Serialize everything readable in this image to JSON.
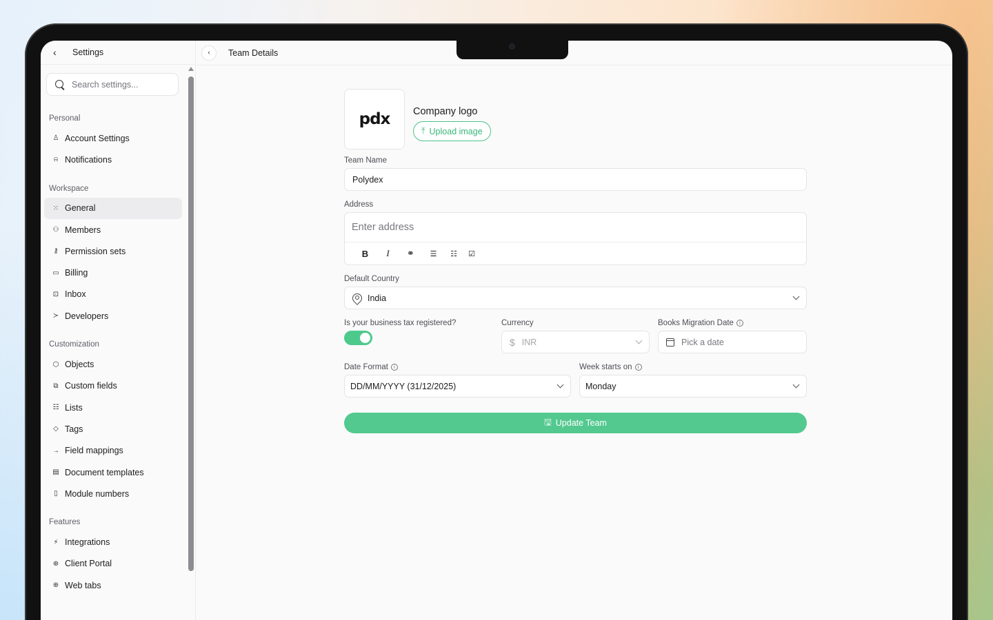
{
  "sidebar": {
    "title": "Settings",
    "search_placeholder": "Search settings...",
    "sections": [
      {
        "label": "Personal",
        "items": [
          {
            "label": "Account Settings",
            "icon": "user-icon",
            "glyph": "♙"
          },
          {
            "label": "Notifications",
            "icon": "bell-icon",
            "glyph": "⍾"
          }
        ]
      },
      {
        "label": "Workspace",
        "items": [
          {
            "label": "General",
            "icon": "grid-icon",
            "glyph": "⁙",
            "active": true
          },
          {
            "label": "Members",
            "icon": "users-icon",
            "glyph": "⚇"
          },
          {
            "label": "Permission sets",
            "icon": "key-icon",
            "glyph": "⚷"
          },
          {
            "label": "Billing",
            "icon": "credit-card-icon",
            "glyph": "▭"
          },
          {
            "label": "Inbox",
            "icon": "inbox-icon",
            "glyph": "⊡"
          },
          {
            "label": "Developers",
            "icon": "terminal-icon",
            "glyph": "≻"
          }
        ]
      },
      {
        "label": "Customization",
        "items": [
          {
            "label": "Objects",
            "icon": "box-icon",
            "glyph": "⬡"
          },
          {
            "label": "Custom fields",
            "icon": "tag-icon",
            "glyph": "⧉"
          },
          {
            "label": "Lists",
            "icon": "list-icon",
            "glyph": "☷"
          },
          {
            "label": "Tags",
            "icon": "tags-icon",
            "glyph": "◇"
          },
          {
            "label": "Field mappings",
            "icon": "arrow-right-icon",
            "glyph": "→"
          },
          {
            "label": "Document templates",
            "icon": "template-icon",
            "glyph": "▤"
          },
          {
            "label": "Module numbers",
            "icon": "file-icon",
            "glyph": "▯"
          }
        ]
      },
      {
        "label": "Features",
        "items": [
          {
            "label": "Integrations",
            "icon": "plug-icon",
            "glyph": "⚡"
          },
          {
            "label": "Client Portal",
            "icon": "globe-icon",
            "glyph": "⊕"
          },
          {
            "label": "Web tabs",
            "icon": "globe-icon",
            "glyph": "⊕"
          }
        ]
      }
    ]
  },
  "header": {
    "title": "Team Details"
  },
  "form": {
    "logo_text": "pdx",
    "logo_label": "Company logo",
    "upload_label": "Upload image",
    "team_name_label": "Team Name",
    "team_name_value": "Polydex",
    "address_label": "Address",
    "address_placeholder": "Enter address",
    "country_label": "Default Country",
    "country_value": "India",
    "tax_label": "Is your business tax registered?",
    "tax_registered": true,
    "currency_label": "Currency",
    "currency_value": "INR",
    "migration_label": "Books Migration Date",
    "migration_placeholder": "Pick a date",
    "date_format_label": "Date Format",
    "date_format_value": "DD/MM/YYYY (31/12/2025)",
    "week_label": "Week starts on",
    "week_value": "Monday",
    "submit_label": "Update Team"
  },
  "colors": {
    "accent": "#4dc98c",
    "accent_text": "#3ab67a"
  }
}
